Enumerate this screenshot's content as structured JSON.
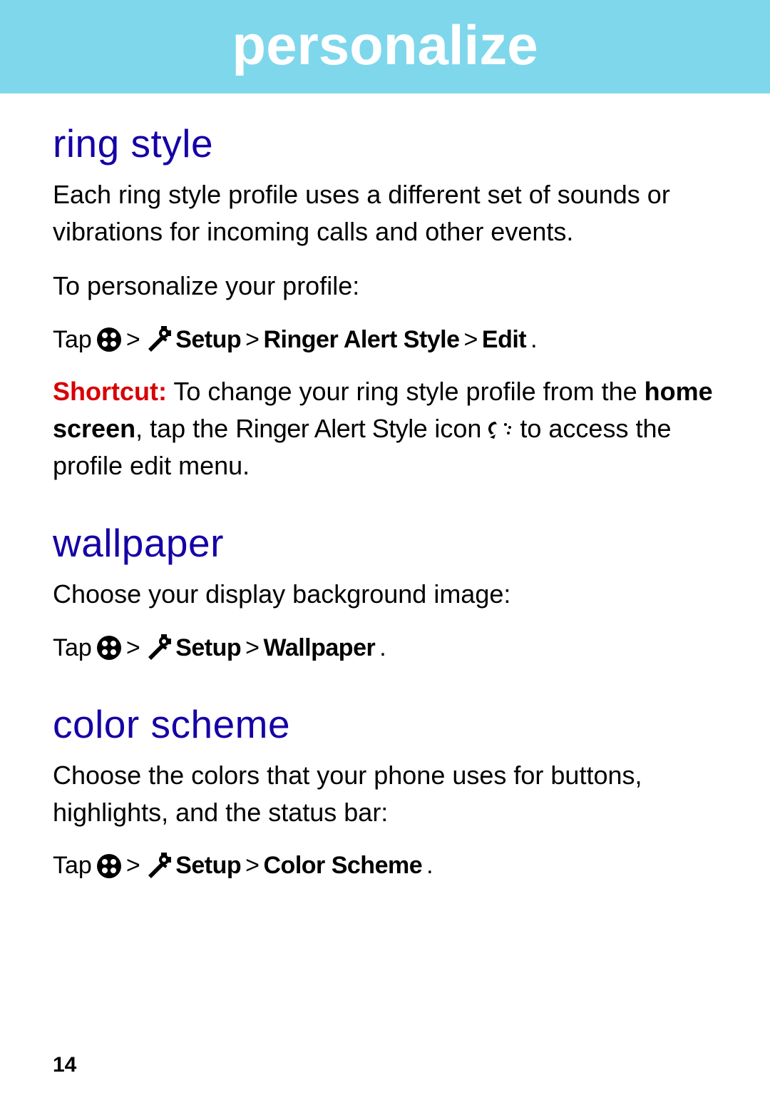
{
  "banner": {
    "title": "personalize"
  },
  "section1": {
    "heading": "ring style",
    "p1": "Each ring style profile uses a different set of sounds or vibrations for incoming calls and other events.",
    "p2": "To personalize your profile:",
    "tap_prefix": "Tap  ",
    "gt1": ">",
    "setup_label": "Setup",
    "gt2": ">",
    "ringer_label": "Ringer Alert Style",
    "gt3": ">",
    "edit_label": "Edit",
    "dot": ".",
    "shortcut_label": "Shortcut:",
    "shortcut_text1": " To change your ring style profile from the ",
    "home_screen": "home screen",
    "shortcut_text2": ", tap the ",
    "ringer_inline": "Ringer Alert Style",
    "shortcut_text3": " icon ",
    "shortcut_text4": " to access the profile edit menu."
  },
  "section2": {
    "heading": "wallpaper",
    "p1": "Choose your display background image:",
    "tap_prefix": "Tap  ",
    "gt1": ">",
    "setup_label": "Setup",
    "gt2": ">",
    "wallpaper_label": "Wallpaper",
    "dot": "."
  },
  "section3": {
    "heading": "color scheme",
    "p1": "Choose the colors that your phone uses for buttons, highlights, and the status bar:",
    "tap_prefix": "Tap  ",
    "gt1": " > ",
    "setup_label": "Setup",
    "gt2": " > ",
    "color_label": "Color Scheme",
    "dot": "."
  },
  "page": {
    "number": "14"
  }
}
